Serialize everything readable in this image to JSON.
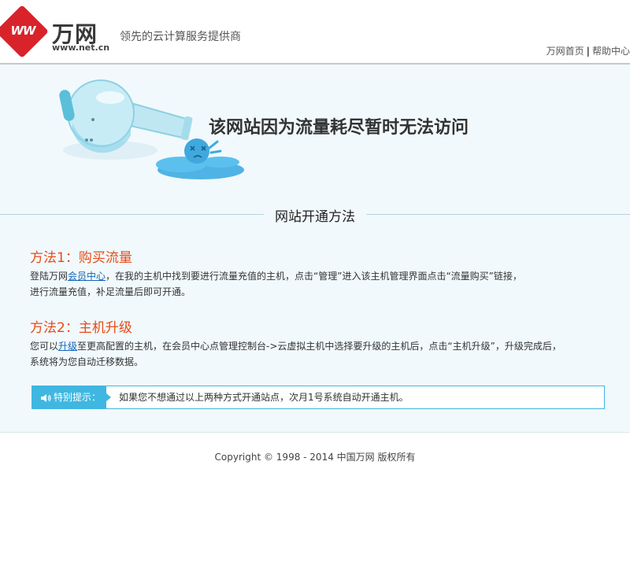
{
  "header": {
    "logo_mark": "WW",
    "logo_name": "万网",
    "logo_url": "www.net.cn",
    "slogan": "领先的云计算服务提供商",
    "links": [
      {
        "label": "万网首页"
      },
      {
        "label": "帮助中心"
      }
    ],
    "separator": "|"
  },
  "main": {
    "headline": "该网站因为流量耗尽暂时无法访问",
    "section_title": "网站开通方法",
    "methods": [
      {
        "title": "方法1：购买流量",
        "line1_before": "登陆万网",
        "line1_link": "会员中心",
        "line1_after": "，在我的主机中找到要进行流量充值的主机，点击“管理”进入该主机管理界面点击“流量购买”链接，",
        "line2": "进行流量充值，补足流量后即可开通。"
      },
      {
        "title": "方法2：主机升级",
        "line1_before": "您可以",
        "line1_link": "升级",
        "line1_after": "至更高配置的主机，在会员中心点管理控制台->云虚拟主机中选择要升级的主机后，点击“主机升级”，升级完成后，",
        "line2": "系统将为您自动迁移数据。"
      }
    ],
    "tip": {
      "label": "特别提示：",
      "text": "如果您不想通过以上两种方式开通站点，次月1号系统自动开通主机。"
    }
  },
  "footer": {
    "copyright": "Copyright © 1998 - 2014 中国万网 版权所有"
  },
  "colors": {
    "brand_red": "#d8232a",
    "accent_blue": "#3fb7e1",
    "method_orange": "#e84b17",
    "link_blue": "#1565b8",
    "main_bg": "#f1f9fc"
  },
  "icons": {
    "logo": "net-cn-logo",
    "illustration": "tipped-flask-illustration",
    "tip": "speaker-icon"
  }
}
